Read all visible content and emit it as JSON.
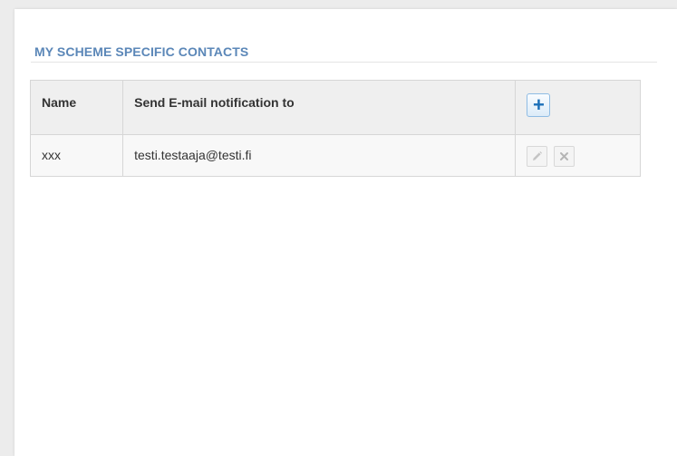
{
  "section": {
    "title": "MY SCHEME SPECIFIC CONTACTS"
  },
  "table": {
    "headers": {
      "name": "Name",
      "email": "Send E-mail notification to"
    },
    "rows": [
      {
        "name": "xxx",
        "email": "testi.testaaja@testi.fi"
      }
    ]
  },
  "icons": {
    "add": "plus-icon",
    "edit": "pencil-icon",
    "delete": "close-icon"
  },
  "colors": {
    "title": "#5b87b8",
    "add_button_icon": "#1b6fb8"
  }
}
